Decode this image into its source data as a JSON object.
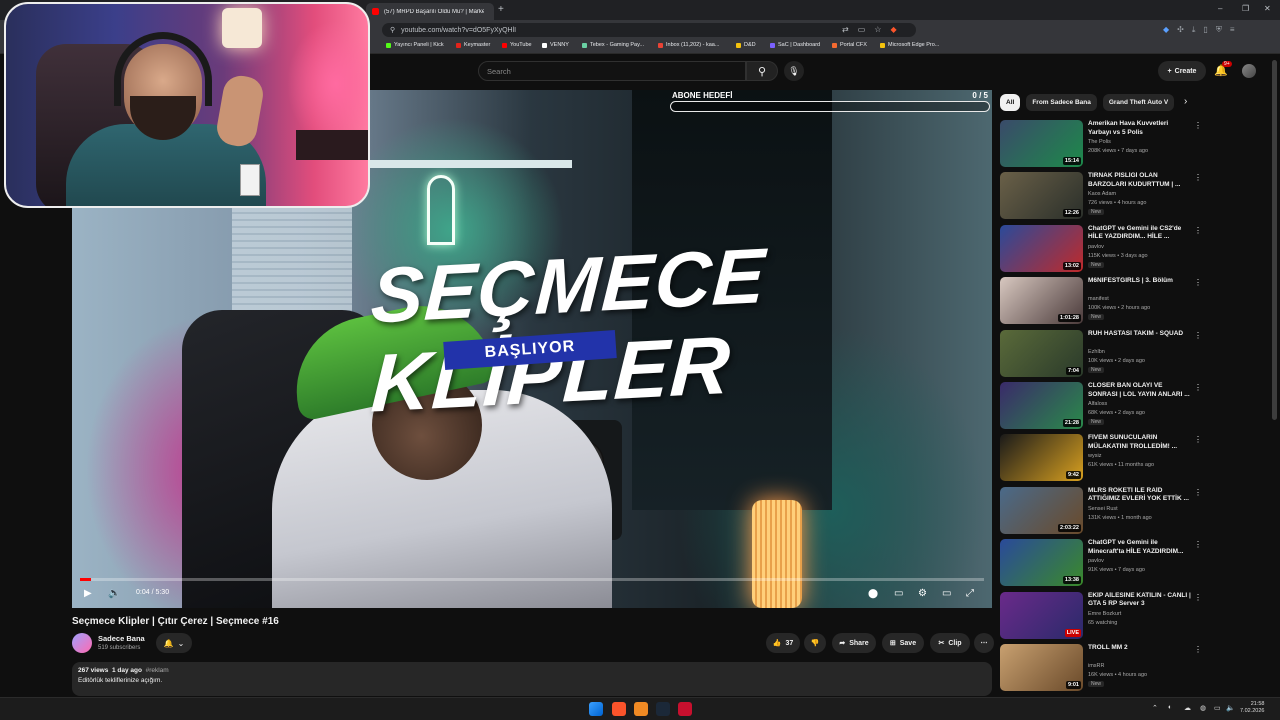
{
  "browser": {
    "tabs": [
      {
        "label": "(57) MRPD Başarılı Oldu Mu? | Marke..."
      }
    ],
    "url": "youtube.com/watch?v=dO5FyXyQHlI",
    "bookmarks": [
      {
        "label": "Yayıncı Paneli | Kick",
        "color": "#53fc18"
      },
      {
        "label": "Keymaster",
        "color": "#e2231a"
      },
      {
        "label": "YouTube",
        "color": "#ff0000"
      },
      {
        "label": "VENNY",
        "color": "#ffffff"
      },
      {
        "label": "Tebex - Gaming Pay...",
        "color": "#6ad1a4"
      },
      {
        "label": "Inbox (11,202) - kaa...",
        "color": "#ea4335"
      },
      {
        "label": "D&D",
        "color": "#f4c20d"
      },
      {
        "label": "SaC | Dashboard",
        "color": "#7b61ff"
      },
      {
        "label": "Portal CFX",
        "color": "#f46a30"
      },
      {
        "label": "Microsoft Edge Pro...",
        "color": "#f4c20d"
      }
    ]
  },
  "youtube_header": {
    "search_placeholder": "Search",
    "create_label": "Create",
    "notification_count": "9+"
  },
  "player": {
    "overlay_line1": "SEÇMECE",
    "overlay_banner": "BAŞLIYOR",
    "overlay_line2": "KLİPLER",
    "goal_title": "ABONE HEDEFİ",
    "goal_count": "0 / 5",
    "goal_progress": 0,
    "time": "0:04 / 5:30",
    "played_fraction": 0.012
  },
  "video": {
    "title": "Seçmece Klipler | Çıtır Çerez | Seçmece #16",
    "channel": "Sadece Bana",
    "subscribers": "519 subscribers",
    "likes": "37",
    "share_label": "Share",
    "save_label": "Save",
    "clip_label": "Clip",
    "views": "267 views",
    "age": "1 day ago",
    "hashtag": "#reklam",
    "description": "Editörlük tekliflerinize açığım."
  },
  "sidebar": {
    "chips": [
      "All",
      "From Sadece Bana",
      "Grand Theft Auto V"
    ],
    "recommendations": [
      {
        "title": "Amerikan Hava Kuvvetleri Yarbayı vs 5 Polis",
        "channel": "The Polis",
        "meta": "208K views • 7 days ago",
        "badge": "",
        "duration": "15:14",
        "thumb": [
          "#3a4a6a",
          "#1d8a4a"
        ]
      },
      {
        "title": "TIRNAK PİSLİĞİ OLAN BARZOLARI KUDURTTUM | ...",
        "channel": "Kaos Adam",
        "meta": "726 views • 4 hours ago",
        "badge": "New",
        "duration": "12:26",
        "thumb": [
          "#6a6048",
          "#2a2f2a"
        ]
      },
      {
        "title": "ChatGPT ve Gemini ile CS2'de HİLE YAZDIRDIM... HİLE ...",
        "channel": "pavlov",
        "meta": "115K views • 3 days ago",
        "badge": "New",
        "duration": "13:02",
        "thumb": [
          "#2a4a9a",
          "#c02a2a"
        ]
      },
      {
        "title": "M6NIFESTGIRLS | 3. Bölüm",
        "channel": "manifest",
        "meta": "100K views • 2 hours ago",
        "badge": "New",
        "duration": "1:01:28",
        "thumb": [
          "#d8c8c0",
          "#4a3a3a"
        ]
      },
      {
        "title": "RUH HASTASI TAKIM - SQUAD",
        "channel": "Ezhlbn",
        "meta": "10K views • 2 days ago",
        "badge": "New",
        "duration": "7:04",
        "thumb": [
          "#5a6a3a",
          "#2a3a2a"
        ]
      },
      {
        "title": "CLOSER BAN OLAYI VE SONRASI | LOL YAYIN ANLARI ...",
        "channel": "Alfaloss",
        "meta": "68K views • 2 days ago",
        "badge": "New",
        "duration": "21:28",
        "thumb": [
          "#3a2a6a",
          "#2a8a4a"
        ]
      },
      {
        "title": "FİVEM SUNUCULARIN MÜLAKATINI TROLLEDİM! ...",
        "channel": "wysiz",
        "meta": "61K views • 11 months ago",
        "badge": "",
        "duration": "9:42",
        "thumb": [
          "#1a1a1a",
          "#d8a020"
        ]
      },
      {
        "title": "MLRS ROKETİ İLE RAİD ATTIĞIMIZ EVLERİ YOK ETTİK ...",
        "channel": "Sensei Rust",
        "meta": "131K views • 1 month ago",
        "badge": "",
        "duration": "2:03:22",
        "thumb": [
          "#4a6a8a",
          "#6a4a2a"
        ]
      },
      {
        "title": "ChatGPT ve Gemini ile Minecraft'ta HİLE YAZDIRDIM...",
        "channel": "pavlov",
        "meta": "91K views • 7 days ago",
        "badge": "",
        "duration": "13:38",
        "thumb": [
          "#2a4a9a",
          "#3a8a2a"
        ]
      },
      {
        "title": "EKİP AİLESİNE KATILIN - CANLI | GTA 5 RP Server 3",
        "channel": "Emre Bozkurt",
        "meta": "65 watching",
        "badge": "",
        "duration": "LIVE",
        "thumb": [
          "#6a2a8a",
          "#2a2a6a"
        ]
      },
      {
        "title": "TROLL MM 2",
        "channel": "imsRR",
        "meta": "16K views • 4 hours ago",
        "badge": "New",
        "duration": "9:01",
        "thumb": [
          "#c8a070",
          "#6a4a2a"
        ]
      }
    ]
  },
  "taskbar": {
    "time": "21:58",
    "date": "7.02.2026"
  }
}
